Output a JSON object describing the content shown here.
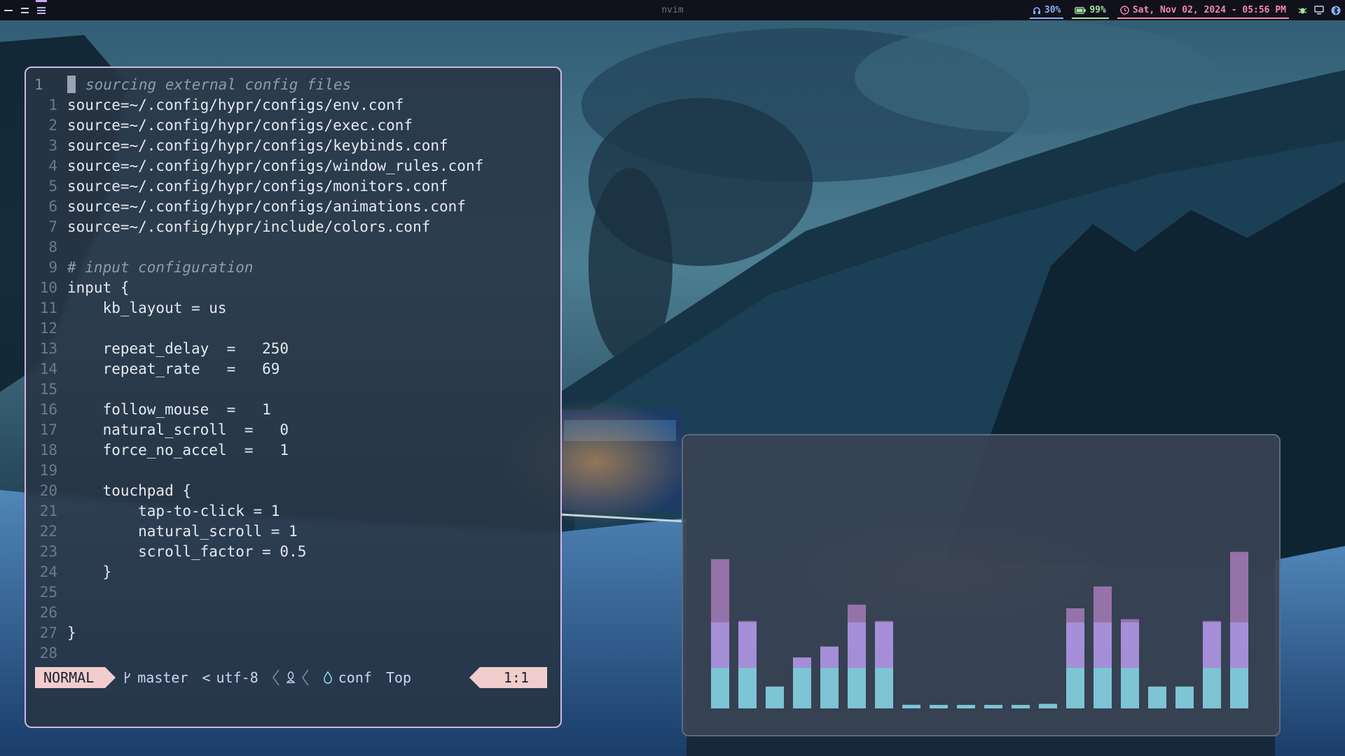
{
  "topbar": {
    "title": "nvim",
    "audio": "30%",
    "battery": "99%",
    "clock": "Sat, Nov 02, 2024 - 05:56 PM",
    "workspaces": [
      {
        "icon": "dash-icon"
      },
      {
        "icon": "equals-icon"
      },
      {
        "icon": "menu-icon",
        "active": true
      }
    ],
    "tray_icons": [
      "bug-icon",
      "display-icon",
      "bluetooth-icon"
    ]
  },
  "editor": {
    "lines": [
      {
        "num": "1",
        "text": "# sourcing external config files",
        "comment": true,
        "current": true
      },
      {
        "num": "1",
        "text": "source=~/.config/hypr/configs/env.conf"
      },
      {
        "num": "2",
        "text": "source=~/.config/hypr/configs/exec.conf"
      },
      {
        "num": "3",
        "text": "source=~/.config/hypr/configs/keybinds.conf"
      },
      {
        "num": "4",
        "text": "source=~/.config/hypr/configs/window_rules.conf"
      },
      {
        "num": "5",
        "text": "source=~/.config/hypr/configs/monitors.conf"
      },
      {
        "num": "6",
        "text": "source=~/.config/hypr/configs/animations.conf"
      },
      {
        "num": "7",
        "text": "source=~/.config/hypr/include/colors.conf"
      },
      {
        "num": "8",
        "text": ""
      },
      {
        "num": "9",
        "text": "# input configuration",
        "comment": true
      },
      {
        "num": "10",
        "text": "input {"
      },
      {
        "num": "11",
        "text": "    kb_layout = us"
      },
      {
        "num": "12",
        "text": ""
      },
      {
        "num": "13",
        "text": "    repeat_delay  =   250"
      },
      {
        "num": "14",
        "text": "    repeat_rate   =   69"
      },
      {
        "num": "15",
        "text": ""
      },
      {
        "num": "16",
        "text": "    follow_mouse  =   1"
      },
      {
        "num": "17",
        "text": "    natural_scroll  =   0"
      },
      {
        "num": "18",
        "text": "    force_no_accel  =   1"
      },
      {
        "num": "19",
        "text": ""
      },
      {
        "num": "20",
        "text": "    touchpad {"
      },
      {
        "num": "21",
        "text": "        tap-to-click = 1"
      },
      {
        "num": "22",
        "text": "        natural_scroll = 1"
      },
      {
        "num": "23",
        "text": "        scroll_factor = 0.5"
      },
      {
        "num": "24",
        "text": "    }"
      },
      {
        "num": "25",
        "text": ""
      },
      {
        "num": "26",
        "text": ""
      },
      {
        "num": "27",
        "text": "}"
      },
      {
        "num": "28",
        "text": ""
      }
    ],
    "statusline": {
      "mode": "NORMAL",
      "branch": "master",
      "encoding": "utf-8",
      "os_icon": "linux-icon",
      "filetype": "conf",
      "position": "Top",
      "cursor": "1:1"
    }
  },
  "visualizer": {
    "levels": [
      0.82,
      0.48,
      0.12,
      0.28,
      0.34,
      0.57,
      0.48,
      0.02,
      0.015,
      0.015,
      0.015,
      0.015,
      0.025,
      0.55,
      0.67,
      0.49,
      0.12,
      0.12,
      0.48,
      0.86
    ],
    "colors": {
      "low": "#89dceb",
      "mid": "#b89cf0",
      "high": "#a67bb8"
    }
  },
  "colors": {
    "bar_bg": "#11111b",
    "accent_pink": "#f2cdcd",
    "border_lavender": "#cdb8e6"
  }
}
